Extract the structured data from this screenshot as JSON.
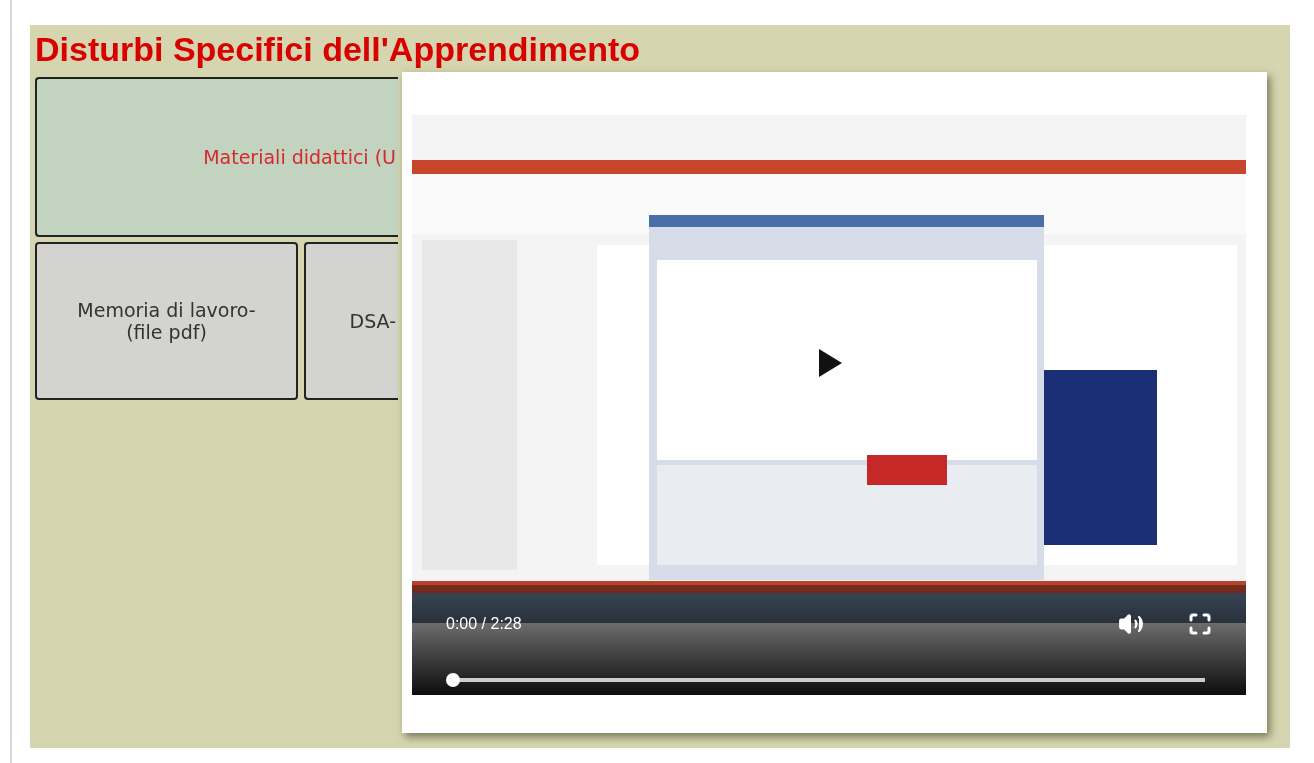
{
  "page": {
    "title": "Disturbi Specifici dell'Apprendimento"
  },
  "tiles": [
    {
      "kind": "wide",
      "label": "Materiali didattici (U"
    },
    {
      "kind": "small",
      "label": "Memoria di lavoro- (file pdf)"
    },
    {
      "kind": "partial",
      "label": "DSA-"
    }
  ],
  "video": {
    "kind": "picture",
    "time": "0:00 / 2:28",
    "progress": {
      "level": 0
    }
  }
}
